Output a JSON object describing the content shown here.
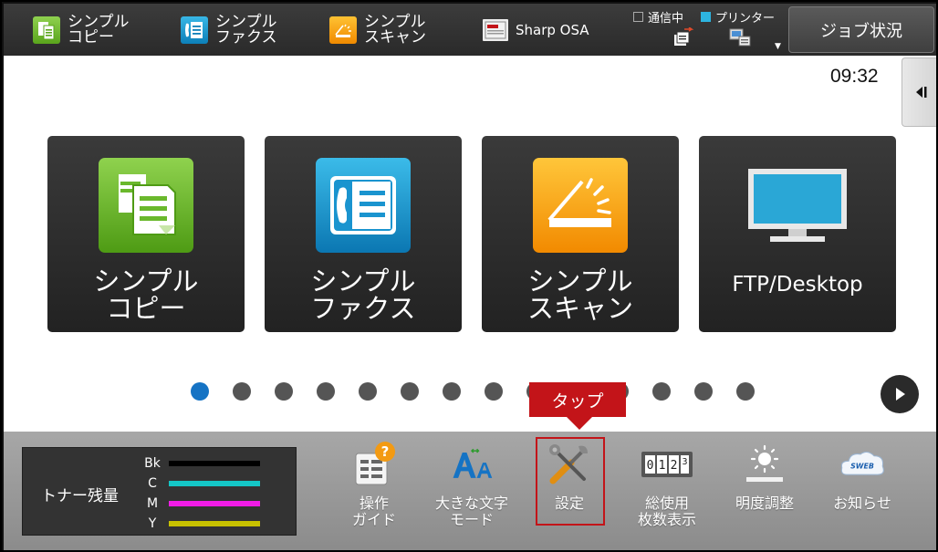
{
  "topbar": {
    "shortcuts": [
      {
        "label": "シンプル\nコピー",
        "icon": "copy-icon"
      },
      {
        "label": "シンプル\nファクス",
        "icon": "fax-icon"
      },
      {
        "label": "シンプル\nスキャン",
        "icon": "scan-icon"
      },
      {
        "label": "Sharp OSA",
        "icon": "osa-icon"
      }
    ],
    "status": {
      "communicating_label": "通信中",
      "printer_label": "プリンター"
    },
    "job_status_label": "ジョブ状況"
  },
  "main": {
    "clock": "09:32",
    "tiles": [
      {
        "label": "シンプル\nコピー",
        "icon": "copy-icon",
        "color": "#6ab82c"
      },
      {
        "label": "シンプル\nファクス",
        "icon": "fax-icon",
        "color": "#1a94cf"
      },
      {
        "label": "シンプル\nスキャン",
        "icon": "scan-icon",
        "color": "#f7a30f"
      },
      {
        "label": "FTP/Desktop",
        "icon": "monitor-icon",
        "color": "#2aa7d6"
      }
    ],
    "page_indicator": {
      "total": 14,
      "current": 1
    },
    "callout_label": "タップ"
  },
  "bottombar": {
    "toner": {
      "title": "トナー残量",
      "rows": [
        {
          "label": "Bk",
          "color": "#000000"
        },
        {
          "label": "C",
          "color": "#14c6c6"
        },
        {
          "label": "M",
          "color": "#f01ce6"
        },
        {
          "label": "Y",
          "color": "#c8c200"
        }
      ]
    },
    "functions": [
      {
        "label": "操作\nガイド",
        "icon": "guide-icon"
      },
      {
        "label": "大きな文字\nモード",
        "icon": "large-text-icon"
      },
      {
        "label": "設定",
        "icon": "settings-icon"
      },
      {
        "label": "総使用\n枚数表示",
        "icon": "counter-icon",
        "counter_digits": "0123"
      },
      {
        "label": "明度調整",
        "icon": "brightness-icon"
      },
      {
        "label": "お知らせ",
        "icon": "news-icon",
        "badge": "SWEB"
      }
    ]
  },
  "colors": {
    "accent_blue": "#1573c4",
    "highlight_red": "#c31419"
  }
}
